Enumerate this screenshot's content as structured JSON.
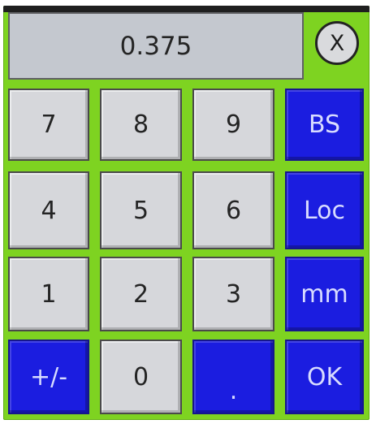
{
  "display": {
    "value": "0.375"
  },
  "close": {
    "label": "X"
  },
  "keys": {
    "k7": "7",
    "k8": "8",
    "k9": "9",
    "bs": "BS",
    "k4": "4",
    "k5": "5",
    "k6": "6",
    "loc": "Loc",
    "k1": "1",
    "k2": "2",
    "k3": "3",
    "mm": "mm",
    "plus_minus": "+/-",
    "k0": "0",
    "dot": ".",
    "ok": "OK"
  },
  "colors": {
    "panel_green": "#7ed321",
    "key_gray": "#d6d7db",
    "key_blue": "#1b1de0",
    "display_bg": "#c4c8cf"
  }
}
